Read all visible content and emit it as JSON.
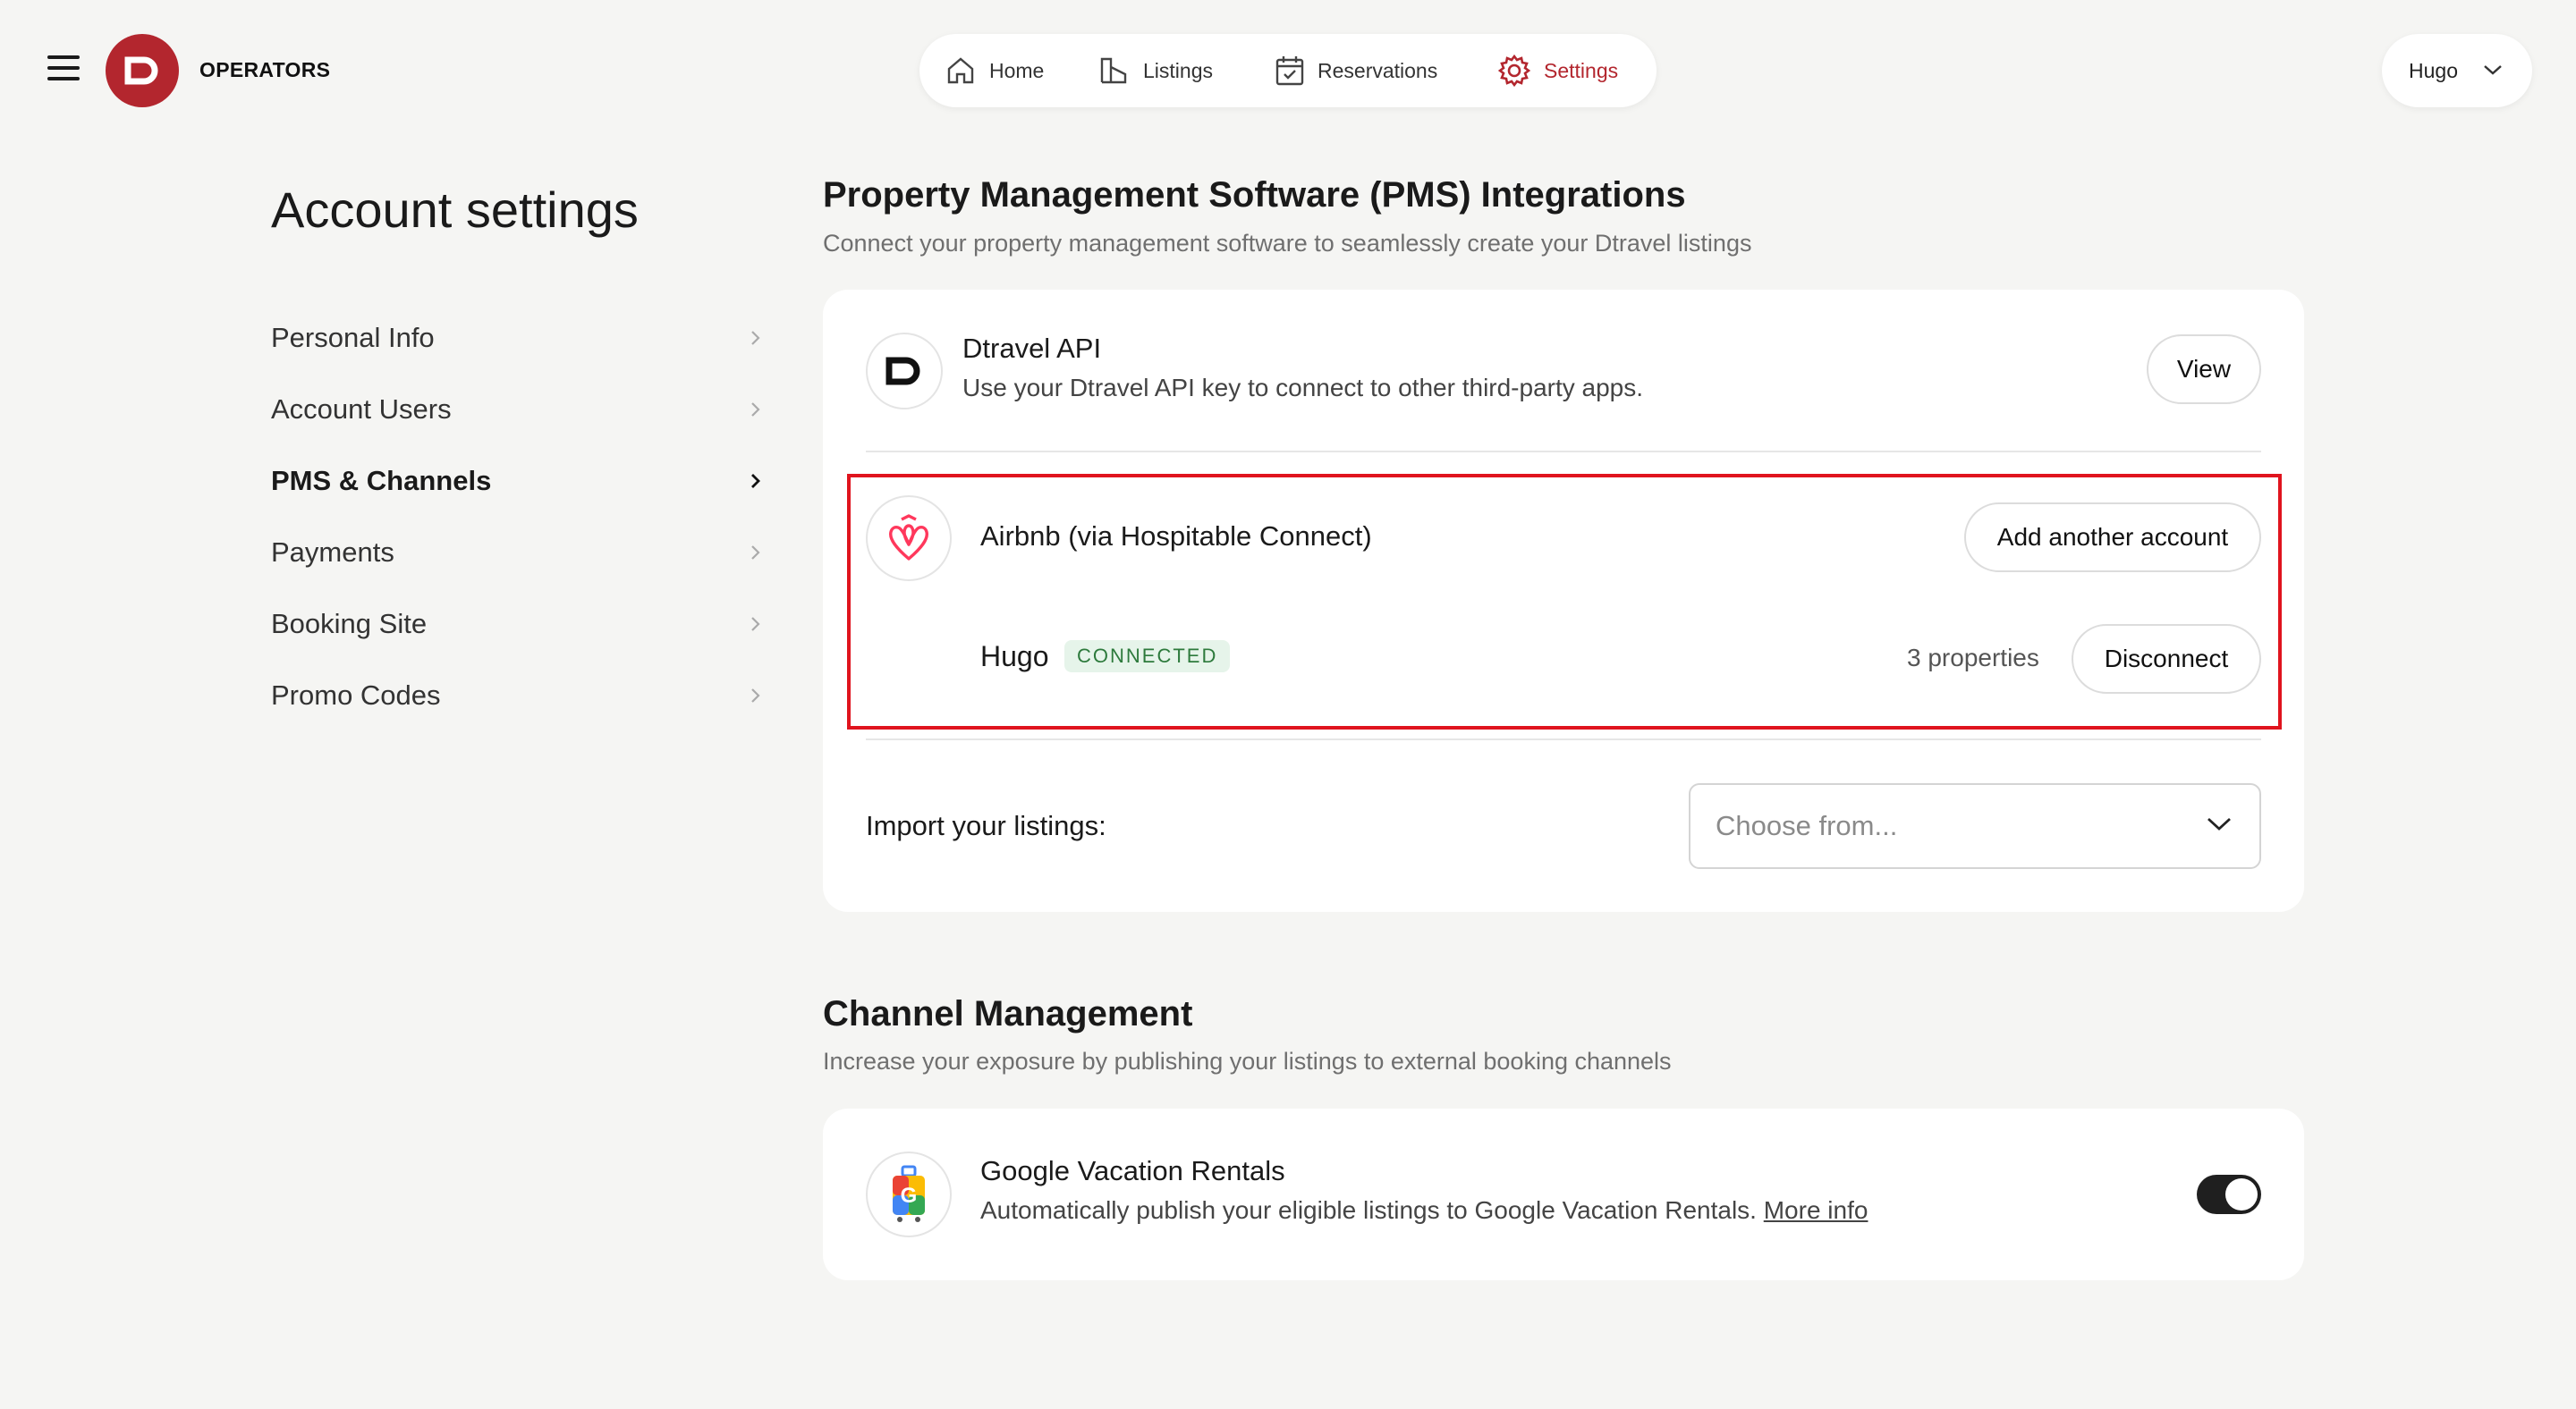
{
  "header": {
    "brand": "OPERATORS",
    "nav": [
      {
        "label": "Home",
        "icon": "home-icon"
      },
      {
        "label": "Listings",
        "icon": "listings-icon"
      },
      {
        "label": "Reservations",
        "icon": "calendar-icon"
      },
      {
        "label": "Settings",
        "icon": "gear-icon",
        "active": true
      }
    ],
    "user": "Hugo",
    "accent_color": "#b3262e"
  },
  "sidebar": {
    "title": "Account settings",
    "items": [
      {
        "label": "Personal Info"
      },
      {
        "label": "Account Users"
      },
      {
        "label": "PMS & Channels",
        "active": true
      },
      {
        "label": "Payments"
      },
      {
        "label": "Booking Site"
      },
      {
        "label": "Promo Codes"
      }
    ]
  },
  "pms": {
    "title": "Property Management Software (PMS) Integrations",
    "subtitle": "Connect your property management software to seamlessly create your Dtravel listings",
    "dtravel_api": {
      "title": "Dtravel API",
      "description": "Use your Dtravel API key to connect to other third-party apps.",
      "button": "View"
    },
    "airbnb": {
      "title": "Airbnb (via Hospitable Connect)",
      "add_button": "Add another account",
      "account_name": "Hugo",
      "status": "CONNECTED",
      "properties": "3 properties",
      "disconnect_button": "Disconnect"
    },
    "import": {
      "label": "Import your listings:",
      "placeholder": "Choose from..."
    }
  },
  "channels": {
    "title": "Channel Management",
    "subtitle": "Increase your exposure by publishing your listings to external booking channels",
    "google": {
      "title": "Google Vacation Rentals",
      "description": "Automatically publish your eligible listings to Google Vacation Rentals.",
      "link": "More info",
      "enabled": true
    }
  }
}
